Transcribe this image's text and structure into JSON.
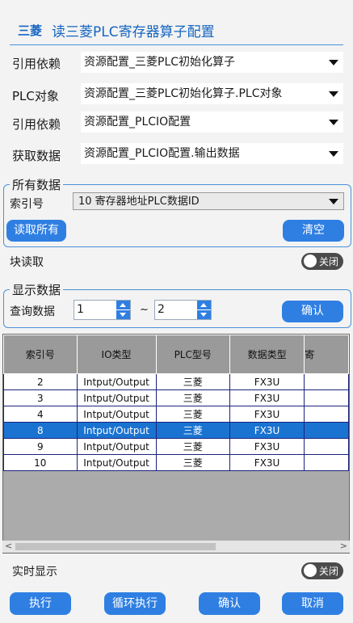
{
  "header": {
    "brand": "三菱",
    "title": "读三菱PLC寄存器算子配置"
  },
  "config_rows": [
    {
      "label": "引用依赖",
      "value": "资源配置_三菱PLC初始化算子"
    },
    {
      "label": "PLC对象",
      "value": "资源配置_三菱PLC初始化算子.PLC对象"
    },
    {
      "label": "引用依赖",
      "value": "资源配置_PLCIO配置"
    },
    {
      "label": "获取数据",
      "value": "资源配置_PLCIO配置.输出数据"
    }
  ],
  "all_data": {
    "title": "所有数据",
    "index_label": "索引号",
    "index_value": "10    寄存器地址PLC数据ID",
    "read_all_button": "读取所有",
    "clear_button": "清空"
  },
  "block_read": {
    "label": "块读取",
    "toggle": "关闭"
  },
  "display_data": {
    "title": "显示数据",
    "query_label": "查询数据",
    "from": "1",
    "tilde": "~",
    "to": "2",
    "confirm_button": "确认"
  },
  "table": {
    "headers": [
      "索引号",
      "IO类型",
      "PLC型号",
      "数据类型",
      "寄"
    ],
    "rows": [
      [
        "2",
        "Intput/Output",
        "三菱",
        "FX3U",
        ""
      ],
      [
        "3",
        "Intput/Output",
        "三菱",
        "FX3U",
        ""
      ],
      [
        "4",
        "Intput/Output",
        "三菱",
        "FX3U",
        ""
      ],
      [
        "8",
        "Intput/Output",
        "三菱",
        "FX3U",
        ""
      ],
      [
        "9",
        "Intput/Output",
        "三菱",
        "FX3U",
        ""
      ],
      [
        "10",
        "Intput/Output",
        "三菱",
        "FX3U",
        ""
      ]
    ],
    "selected_row": 3,
    "scroll_left": "<",
    "scroll_right": ">"
  },
  "realtime": {
    "label": "实时显示",
    "toggle": "关闭"
  },
  "footer": {
    "execute": "执行",
    "loop": "循环执行",
    "confirm": "确认",
    "cancel": "取消"
  },
  "colors": {
    "accent": "#2f7fe3",
    "selected_row": "#1a73d1",
    "title": "#1565c0"
  }
}
